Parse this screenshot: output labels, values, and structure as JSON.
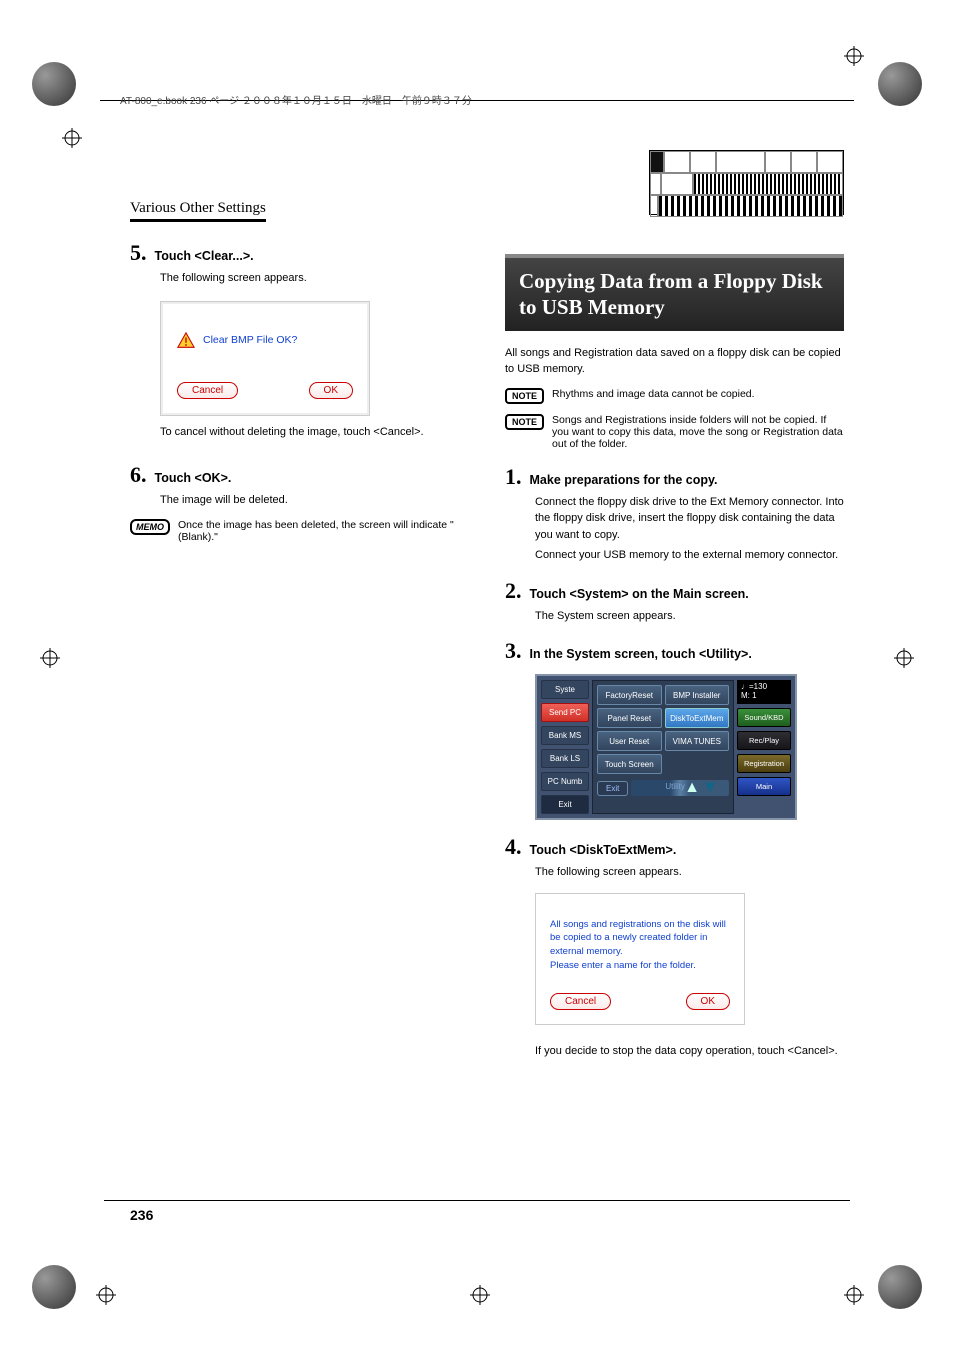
{
  "meta": {
    "book_line": "AT-800_e.book 236 ページ ２００８年１０月１５日　水曜日　午前９時３７分"
  },
  "left": {
    "section_header": "Various Other Settings",
    "step5": {
      "num": "5.",
      "title": "Touch <Clear...>.",
      "body1": "The following screen appears.",
      "dialog_msg": "Clear BMP File OK?",
      "dialog_cancel": "Cancel",
      "dialog_ok": "OK",
      "body2": "To cancel without deleting the image, touch <Cancel>."
    },
    "step6": {
      "num": "6.",
      "title": "Touch <OK>.",
      "body1": "The image will be deleted.",
      "memo_label": "MEMO",
      "memo_text": "Once the image has been deleted, the screen will indicate \"(Blank).\""
    }
  },
  "right": {
    "heading": "Copying Data from a Floppy Disk to USB Memory",
    "intro": "All songs and Registration data saved on a floppy disk can be copied to USB memory.",
    "note1": {
      "label": "NOTE",
      "text": "Rhythms and image data cannot be copied."
    },
    "note2": {
      "label": "NOTE",
      "text": "Songs and Registrations inside folders will not be copied. If you want to copy this data, move the song or Registration data out of the folder."
    },
    "step1": {
      "num": "1.",
      "title": "Make preparations for the copy.",
      "body1": "Connect the floppy disk drive to the Ext Memory connector. Into the floppy disk drive, insert the floppy disk containing the data you want to copy.",
      "body2": "Connect your USB memory to the external memory connector."
    },
    "step2": {
      "num": "2.",
      "title": "Touch <System> on the Main screen.",
      "body1": "The System screen appears."
    },
    "step3": {
      "num": "3.",
      "title": "In the System screen, touch <Utility>."
    },
    "sys": {
      "left_tabs": [
        "Syste",
        "Send PC",
        "Bank MS",
        "Bank LS",
        "PC Numb",
        "Exit"
      ],
      "mid_row1": [
        "FactoryReset",
        "BMP Installer"
      ],
      "mid_row2": [
        "Panel Reset",
        "DiskToExtMem"
      ],
      "mid_row3": [
        "User Reset",
        "VIMA TUNES"
      ],
      "mid_row4": [
        "Touch Screen",
        ""
      ],
      "mid_exit": "Exit",
      "util_label": "Utility",
      "tempo": "♩=130",
      "measure": "M:    1",
      "rbtns": [
        "Sound/KBD",
        "Rec/Play",
        "Registration",
        "Main"
      ]
    },
    "step4": {
      "num": "4.",
      "title": "Touch <DiskToExtMem>.",
      "body1": "The following screen appears.",
      "dialog_text": "All songs and registrations on the disk will be copied to a newly created folder in external memory.\nPlease enter a name for the folder.",
      "dialog_cancel": "Cancel",
      "dialog_ok": "OK",
      "body2": "If you decide to stop the data copy operation, touch <Cancel>."
    }
  },
  "page_number": "236"
}
